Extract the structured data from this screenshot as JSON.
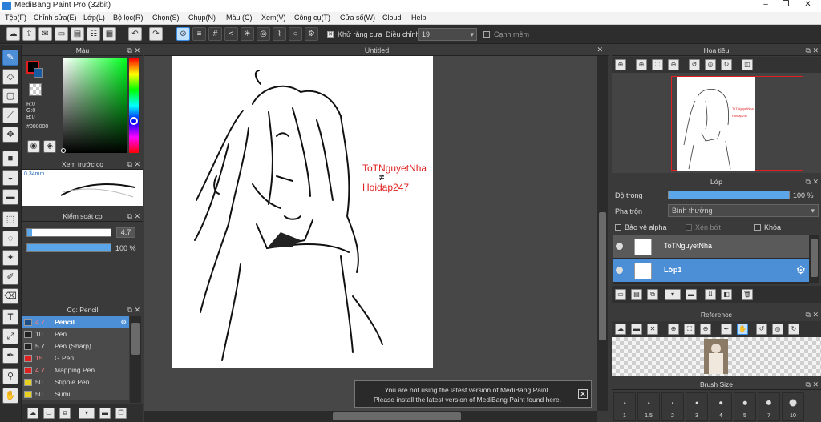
{
  "app": {
    "title": "MediBang Paint Pro (32bit)"
  },
  "menu": [
    "Tệp(F)",
    "Chỉnh sửa(E)",
    "Lớp(L)",
    "Bộ lọc(R)",
    "Chọn(S)",
    "Chụp(N)",
    "Màu (C)",
    "Xem(V)",
    "Công cụ(T)",
    "Cửa sổ(W)",
    "Cloud",
    "Help"
  ],
  "toolbar": {
    "antialias_label": "Khử răng cưa",
    "correction_label": "Điều chỉnh",
    "correction_value": "19",
    "canh_mem_label": "Cạnh mềm"
  },
  "color_panel": {
    "title": "Màu",
    "r": "R:0",
    "g": "G:0",
    "b": "B:0",
    "hex": "#000000"
  },
  "brush_preview": {
    "title": "Xem trước cọ",
    "size": "0.34mm"
  },
  "brush_control": {
    "title": "Kiểm soát cọ",
    "size_value": "4.7",
    "opacity_value": "100 %",
    "opacity_fraction": 1.0
  },
  "brush_list": {
    "title": "Cọ: Pencil",
    "items": [
      {
        "size": "4.7",
        "name": "Pencil",
        "color": "#1f4f86",
        "selected": true
      },
      {
        "size": "10",
        "name": "Pen",
        "color": "#222222"
      },
      {
        "size": "5.7",
        "name": "Pen (Sharp)",
        "color": "#222222"
      },
      {
        "size": "15",
        "name": "G Pen",
        "color": "#e02020"
      },
      {
        "size": "4.7",
        "name": "Mapping Pen",
        "color": "#e02020"
      },
      {
        "size": "50",
        "name": "Stipple Pen",
        "color": "#e8d020"
      },
      {
        "size": "50",
        "name": "Sumi",
        "color": "#e8d020"
      }
    ]
  },
  "canvas": {
    "tab": "Untitled",
    "annotation_line1": "ToTNguyetNha",
    "annotation_line2": "Hoidap247",
    "annotation_color": "#e02020"
  },
  "notice": {
    "line1": "You are not using the latest version of MediBang Paint.",
    "line2": "Please install the latest version of MediBang Paint found here."
  },
  "navigator": {
    "title": "Hoa tiêu",
    "thumb_text1": "ToTNguyetNha",
    "thumb_text2": "Hoidap247"
  },
  "layers": {
    "title": "Lớp",
    "opacity_label": "Độ trong",
    "opacity_value": "100 %",
    "opacity_fraction": 1.0,
    "blend_label": "Pha trộn",
    "blend_value": "Bình thường",
    "protect_alpha": "Bảo vệ alpha",
    "clipping": "Xén bớt",
    "lock": "Khóa",
    "items": [
      {
        "name": "ToTNguyetNha",
        "selected": false
      },
      {
        "name": "Lớp1",
        "selected": true
      }
    ]
  },
  "reference": {
    "title": "Reference"
  },
  "brush_size": {
    "title": "Brush Size",
    "sizes": [
      "1",
      "1.5",
      "2",
      "3",
      "4",
      "5",
      "7",
      "10"
    ]
  }
}
